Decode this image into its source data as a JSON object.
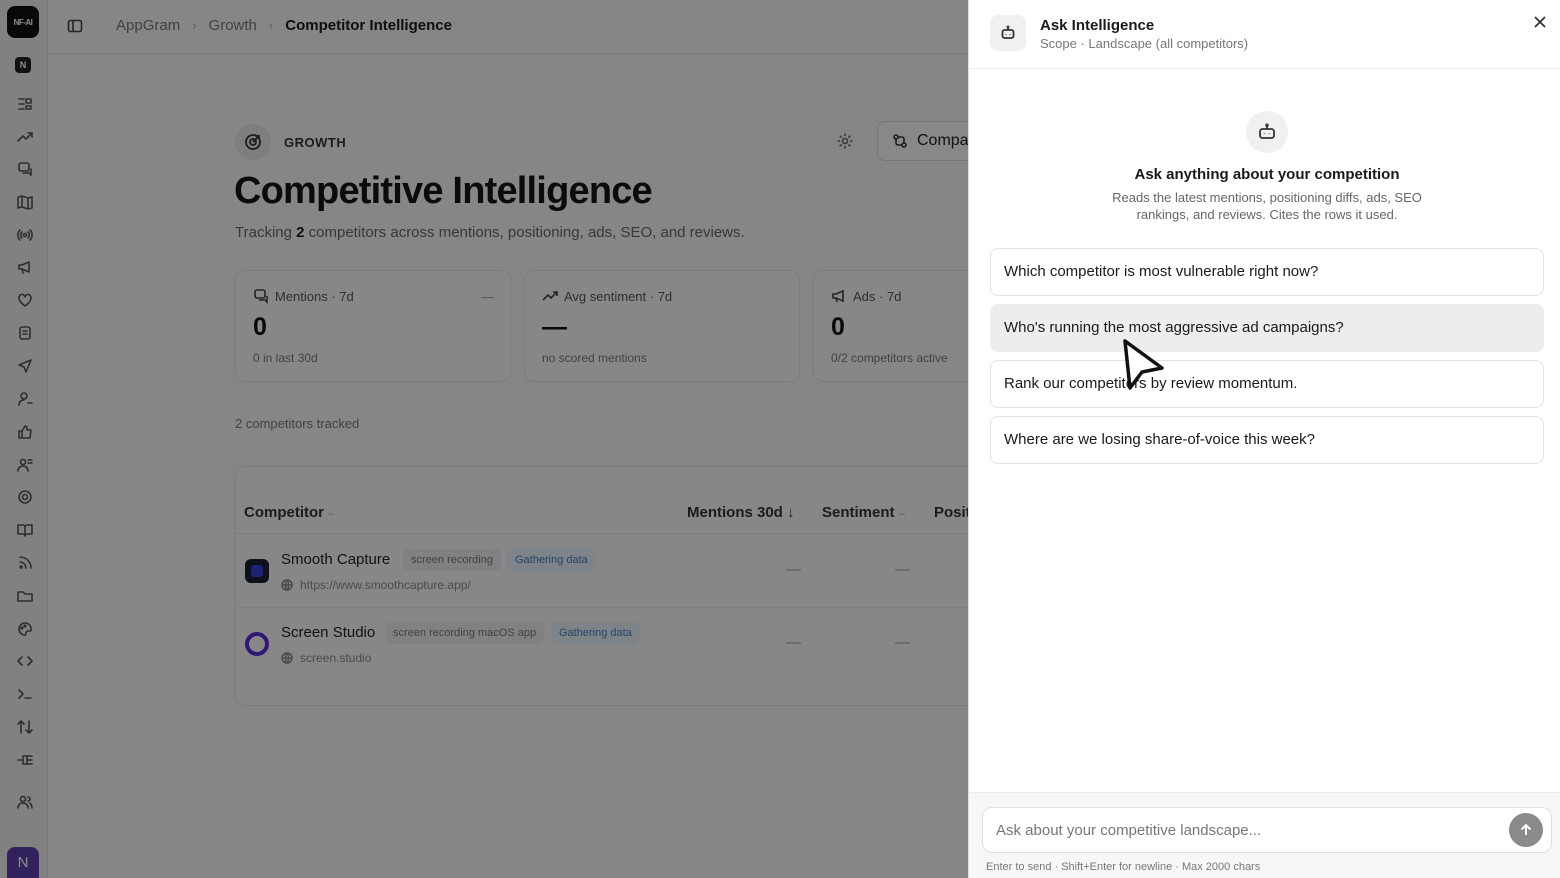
{
  "rail": {
    "logo_text": "NF-AI",
    "workspace_initial": "N",
    "avatar_initial": "N",
    "icons": [
      "inbox-icon",
      "trend-icon",
      "chat-icon",
      "map-icon",
      "broadcast-icon",
      "megaphone-icon",
      "heart-icon",
      "document-icon",
      "send-icon",
      "person-icon",
      "thumbs-up-icon",
      "people-icon",
      "target-icon",
      "book-icon",
      "rss-icon",
      "folder-icon",
      "palette-icon",
      "code-icon",
      "terminal-icon",
      "sort-icon",
      "workflow-icon",
      "team-icon"
    ]
  },
  "breadcrumb": {
    "items": [
      "AppGram",
      "Growth"
    ],
    "current": "Competitor Intelligence"
  },
  "page": {
    "section_label": "GROWTH",
    "compare_label": "Compa",
    "title": "Competitive Intelligence",
    "subtitle_prefix": "Tracking ",
    "subtitle_count": "2",
    "subtitle_suffix": " competitors across mentions, positioning, ads, SEO, and reviews."
  },
  "stats": [
    {
      "label": "Mentions · 7d",
      "value": "0",
      "foot": "0 in last 30d",
      "trend": "—"
    },
    {
      "label": "Avg sentiment · 7d",
      "value": "—",
      "foot": "no scored mentions"
    },
    {
      "label": "Ads · 7d",
      "value": "0",
      "foot": "0/2 competitors active"
    }
  ],
  "tracked_text": "2 competitors tracked",
  "table": {
    "headers": {
      "competitor": "Competitor",
      "competitor_sort": "–",
      "mentions": "Mentions 30d ↓",
      "sentiment": "Sentiment",
      "sentiment_sort": "–",
      "positioning": "Positi"
    },
    "rows": [
      {
        "name": "Smooth Capture",
        "category": "screen recording",
        "status": "Gathering data",
        "url": "https://www.smoothcapture.app/",
        "mentions": "—",
        "sentiment": "—"
      },
      {
        "name": "Screen Studio",
        "category": "screen recording macOS app",
        "status": "Gathering data",
        "url": "screen.studio",
        "mentions": "—",
        "sentiment": "—"
      }
    ]
  },
  "panel": {
    "title": "Ask Intelligence",
    "scope": "Scope · Landscape (all competitors)",
    "hero_title": "Ask anything about your competition",
    "hero_desc": "Reads the latest mentions, positioning diffs, ads, SEO rankings, and reviews. Cites the rows it used.",
    "suggestions": [
      "Which competitor is most vulnerable right now?",
      "Who's running the most aggressive ad campaigns?",
      "Rank our competitors by review momentum.",
      "Where are we losing share-of-voice this week?"
    ],
    "input_placeholder": "Ask about your competitive landscape...",
    "hint": "Enter to send · Shift+Enter for newline · Max 2000 chars"
  }
}
